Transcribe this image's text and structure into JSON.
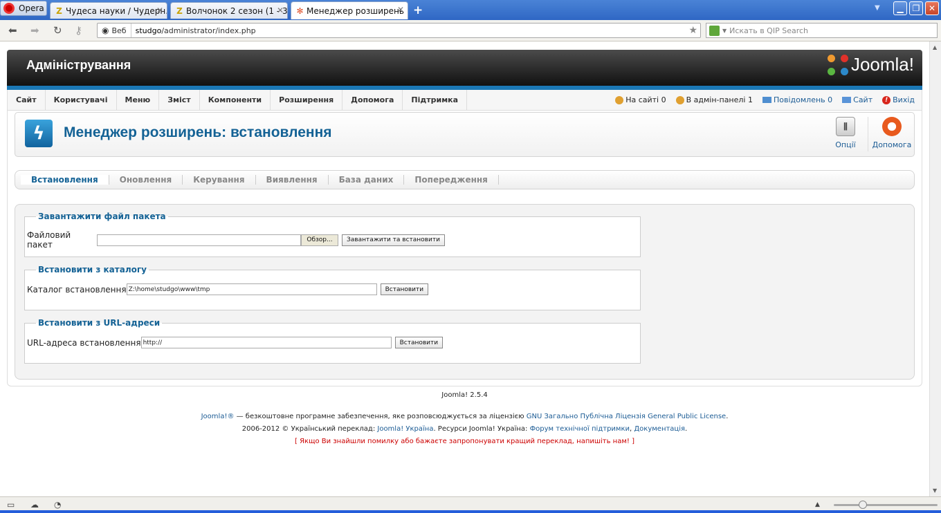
{
  "browser": {
    "app_label": "Opera",
    "tabs": [
      {
        "label": "Чудеса науки / Чудерн..."
      },
      {
        "label": "Волчонок 2 сезон (1 - 3 ..."
      },
      {
        "label": "Менеджер розширень ..."
      }
    ],
    "address_mode": "Веб",
    "url_host": "studgo",
    "url_path": "/administrator/index.php",
    "search_placeholder": "Искать в QIP Search"
  },
  "header": {
    "title": "Адміністрування",
    "logo_text": "Joomla!"
  },
  "menu": {
    "items": [
      "Сайт",
      "Користувачі",
      "Меню",
      "Зміст",
      "Компоненти",
      "Розширення",
      "Допомога",
      "Підтримка"
    ]
  },
  "status": {
    "on_site": "На сайті 0",
    "in_admin": "В адмін-панелі 1",
    "messages": "Повідомлень 0",
    "site": "Сайт",
    "logout": "Вихід"
  },
  "toolbar": {
    "title": "Менеджер розширень: встановлення",
    "options_label": "Опції",
    "help_label": "Допомога"
  },
  "submenu": {
    "items": [
      "Встановлення",
      "Оновлення",
      "Керування",
      "Виявлення",
      "База даних",
      "Попередження"
    ]
  },
  "upload": {
    "legend": "Завантажити файл пакета",
    "label": "Файловий пакет",
    "browse": "Обзор...",
    "button": "Завантажити та встановити"
  },
  "folder": {
    "legend": "Встановити з каталогу",
    "label": "Каталог встановлення",
    "value": "Z:\\home\\studgo\\www\\tmp",
    "button": "Встановити"
  },
  "url": {
    "legend": "Встановити з URL-адреси",
    "label": "URL-адреса встановлення",
    "value": "http://",
    "button": "Встановити"
  },
  "footer": {
    "version": "Joomla! 2.5.4",
    "line1_link": "Joomla!®",
    "line1_text": " — безкоштовне програмне забезпечення, яке розповсюджується за ліцензією ",
    "line1_license": "GNU Загально Публічна Ліцензія General Public License",
    "line1_end": ".",
    "line2_text": "2006-2012 © Український переклад: ",
    "line2_link1": "Joomla! Україна",
    "line2_mid": ". Ресурси Joomla! Україна: ",
    "line2_link2": "Форум технічної підтримки",
    "line2_comma": ", ",
    "line2_link3": "Документація",
    "line2_end": ".",
    "line3": "[ Якщо Ви знайшли помилку або бажаєте запропонувати кращий переклад, напишіть нам! ]"
  }
}
